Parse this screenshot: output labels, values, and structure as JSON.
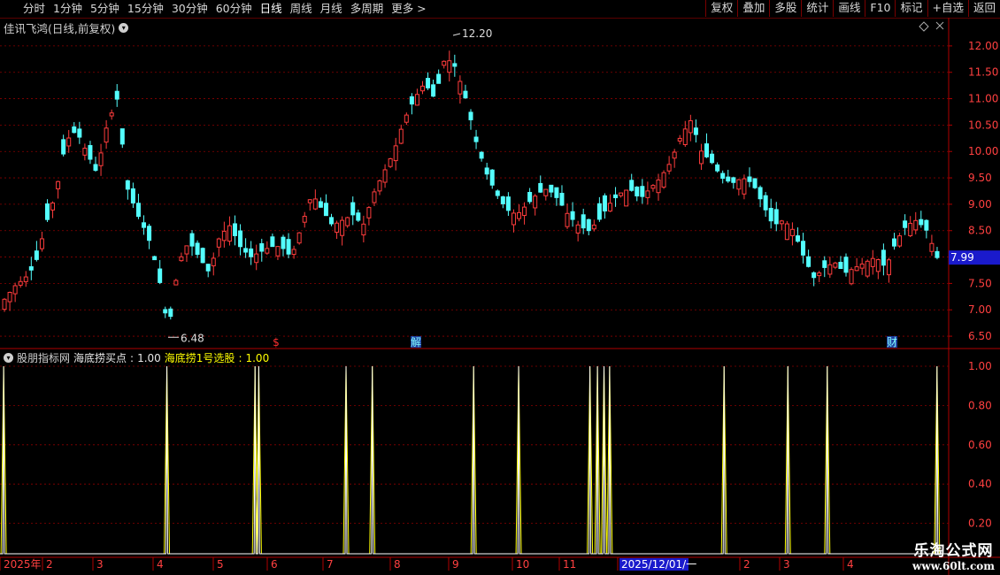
{
  "toolbar": {
    "periods": [
      "分时",
      "1分钟",
      "5分钟",
      "15分钟",
      "30分钟",
      "60分钟",
      "日线",
      "周线",
      "月线",
      "多周期",
      "更多 >"
    ],
    "active_period": "日线",
    "actions": [
      "复权",
      "叠加",
      "多股",
      "统计",
      "画线",
      "F10",
      "标记",
      "+自选",
      "返回"
    ]
  },
  "main_chart": {
    "title": "佳讯飞鸿(日线,前复权)",
    "high_label": "12.20",
    "low_label": "6.48",
    "current_price": "7.99",
    "markers": [
      "$",
      "解",
      "财"
    ],
    "y_ticks": [
      "12.00",
      "11.50",
      "11.00",
      "10.50",
      "10.00",
      "9.50",
      "9.00",
      "8.50",
      "8.00",
      "7.50",
      "7.00",
      "6.50"
    ]
  },
  "indicator": {
    "name": "股朋指标网",
    "buy_label": "海底捞买点",
    "buy_value": "1.00",
    "pick_label": "海底捞1号选股",
    "pick_value": "1.00",
    "y_ticks": [
      "1.00",
      "0.80",
      "0.60",
      "0.40",
      "0.20"
    ]
  },
  "x_axis": {
    "labels": [
      "2025年",
      "2",
      "3",
      "4",
      "5",
      "6",
      "7",
      "8",
      "9",
      "10",
      "11",
      "2025/12/01/一",
      "2",
      "3",
      "4"
    ]
  },
  "watermark": {
    "line1": "乐淘公式网",
    "line2": "www.60lt.com"
  },
  "colors": {
    "up": "#ff3c3c",
    "down": "#54ffff",
    "signal": "#ffff00",
    "grid": "#8b0000"
  },
  "chart_data": {
    "type": "candlestick",
    "ohlc_trend": [
      7.2,
      7.45,
      7.6,
      7.85,
      8.6,
      9.2,
      10.2,
      10.4,
      10.0,
      9.6,
      10.5,
      11.0,
      9.3,
      8.8,
      8.4,
      7.7,
      6.6,
      7.9,
      8.3,
      8.0,
      7.7,
      8.4,
      8.6,
      8.2,
      8.0,
      8.1,
      8.2,
      8.2,
      8.0,
      8.6,
      9.2,
      8.9,
      8.6,
      8.7,
      8.8,
      8.6,
      9.2,
      9.6,
      10.0,
      10.6,
      11.0,
      11.3,
      11.0,
      11.8,
      11.6,
      11.0,
      10.2,
      9.6,
      9.2,
      8.9,
      8.8,
      9.0,
      9.2,
      9.3,
      9.1,
      8.8,
      8.6,
      8.5,
      8.7,
      9.0,
      9.2,
      9.3,
      9.1,
      9.3,
      9.5,
      9.8,
      10.3,
      10.6,
      10.0,
      9.8,
      9.5,
      9.4,
      9.5,
      9.4,
      9.0,
      8.6,
      8.7,
      8.5,
      8.0,
      7.6,
      7.8,
      7.9,
      7.7,
      7.8,
      7.9,
      8.0,
      7.8,
      8.3,
      8.6,
      8.7,
      8.5,
      7.99
    ],
    "ylim": [
      6.3,
      12.3
    ],
    "signals_x_fraction": [
      0.002,
      0.176,
      0.27,
      0.274,
      0.367,
      0.395,
      0.503,
      0.551,
      0.627,
      0.635,
      0.642,
      0.648,
      0.77,
      0.838,
      0.88,
      0.997
    ]
  }
}
